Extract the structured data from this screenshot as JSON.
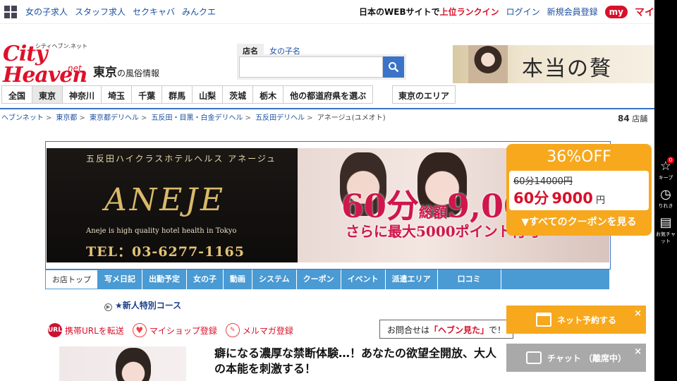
{
  "topbar": {
    "links": [
      "女の子求人",
      "スタッフ求人",
      "セクキャバ",
      "みんクエ"
    ],
    "rank_prefix": "日本のWEBサイトで",
    "rank_highlight": "上位ランクイン",
    "login": "ログイン",
    "register": "新規会員登録",
    "my_badge": "my",
    "my_text": "マイ"
  },
  "logo": {
    "top": "シティヘブン.ネット",
    "main": "City Heaven",
    "sub": "net"
  },
  "area": {
    "name": "東京",
    "suffix": "の風俗情報"
  },
  "search": {
    "tabs": [
      "店名",
      "女の子名"
    ],
    "placeholder": ""
  },
  "top_banner": {
    "text": "本当の贅"
  },
  "prefectures": [
    "全国",
    "東京",
    "神奈川",
    "埼玉",
    "千葉",
    "群馬",
    "山梨",
    "茨城",
    "栃木",
    "他の都道府県を選ぶ"
  ],
  "pref_area": "東京のエリア",
  "breadcrumb": [
    "ヘブンネット",
    "東京都",
    "東京都デリヘル",
    "五反田・目黒・白金デリヘル",
    "五反田デリヘル",
    "アネージュ(ユメオト)"
  ],
  "shop_count": {
    "value": "84",
    "unit": "店舗"
  },
  "shop_banner": {
    "subtitle": "五反田ハイクラスホテルヘルス アネージュ",
    "logo": "ANEJE",
    "tagline": "Aneje is high quality hotel health in Tokyo",
    "tel": "TEL：03-6277-1165",
    "price": "60分",
    "price_total": "総額",
    "price_value": "9,00",
    "point": "さらに最大5000ポイント付与"
  },
  "shop_menu": [
    "お店トップ",
    "写メ日記",
    "出勤予定",
    "女の子",
    "動画",
    "システム",
    "クーポン",
    "イベント",
    "派遣エリア",
    "口コミ"
  ],
  "new_course": "★新人特別コース",
  "actions": [
    {
      "icon": "url-icon",
      "label": "携帯URLを転送"
    },
    {
      "icon": "heart-icon",
      "label": "マイショップ登録"
    },
    {
      "icon": "mail-icon",
      "label": "メルマガ登録"
    }
  ],
  "contact": {
    "prefix": "お問合せは",
    "highlight": "「ヘブン見た」",
    "suffix": "で！"
  },
  "headline": "癖になる濃厚な禁断体験…！あなたの欲望全開放、大人の本能を刺激する！",
  "coupon": {
    "title": "36%OFF",
    "old": "60分14000円",
    "new_prefix": "60分",
    "new_price": "9000",
    "new_unit": "円",
    "link": "▼すべてのクーポンを見る"
  },
  "float": {
    "reserve": "ネット予約する",
    "chat": "チャット （離席中）",
    "close": "×"
  },
  "side": {
    "keep": "キープ",
    "keep_badge": "0",
    "history": "りれき",
    "chat": "お気チャット"
  }
}
